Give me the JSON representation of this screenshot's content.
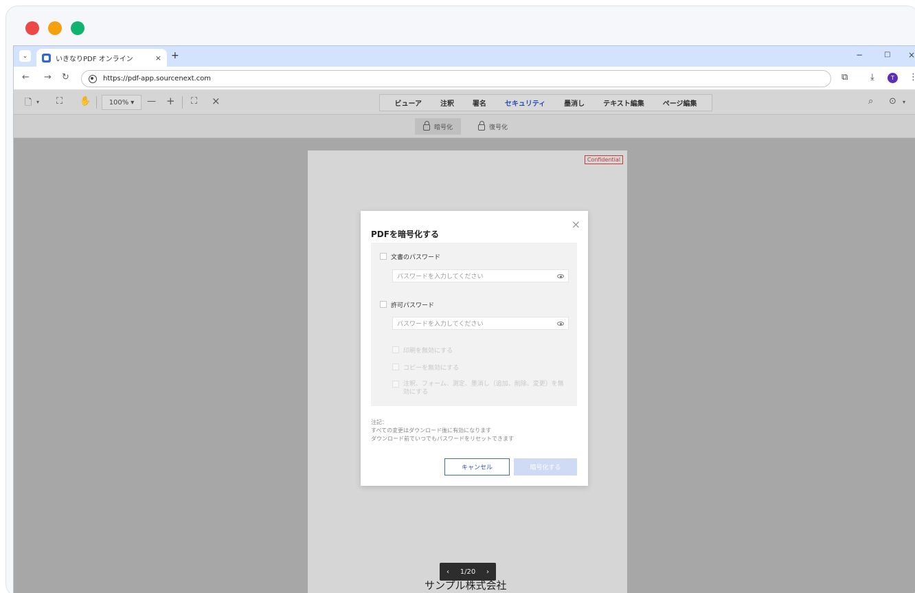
{
  "window": {
    "controls": {
      "close_color": "#ed4845",
      "minimize_color": "#f5a00f",
      "maximize_color": "#11b46e"
    }
  },
  "browser": {
    "tab_title": "いきなりPDF オンライン",
    "tab_close": "×",
    "new_tab": "+",
    "url": "https://pdf-app.sourcenext.com",
    "avatar_letter": "T",
    "win_min": "−",
    "win_max": "□",
    "win_close": "×"
  },
  "toolbar": {
    "zoom": "100%",
    "zoom_minus": "—",
    "zoom_plus": "+",
    "close_x": "×",
    "tabs": [
      {
        "label": "ビューア",
        "active": false
      },
      {
        "label": "注釈",
        "active": false
      },
      {
        "label": "署名",
        "active": false
      },
      {
        "label": "セキュリティ",
        "active": true
      },
      {
        "label": "墨消し",
        "active": false
      },
      {
        "label": "テキスト編集",
        "active": false
      },
      {
        "label": "ページ編集",
        "active": false
      }
    ]
  },
  "subbar": {
    "encrypt_label": "暗号化",
    "decrypt_label": "復号化"
  },
  "document": {
    "badge": "Confidential",
    "footer": "サンプル株式会社",
    "pager": {
      "current": "1/20",
      "prev": "‹",
      "next": "›"
    }
  },
  "modal": {
    "title": "PDFを暗号化する",
    "close": "×",
    "doc_password_label": "文書のパスワード",
    "doc_password_placeholder": "パスワードを入力してください",
    "perm_password_label": "許可パスワード",
    "perm_password_placeholder": "パスワードを入力してください",
    "options": [
      "印刷を無効にする",
      "コピーを無効にする",
      "注釈、フォーム、測定、墨消し（追加、削除、変更）を無効にする"
    ],
    "note_title": "注記：",
    "note_line1": "すべての変更はダウンロード後に有効になります",
    "note_line2": "ダウンロード前でいつでもパスワードをリセットできます",
    "cancel_label": "キャンセル",
    "encrypt_label": "暗号化する"
  }
}
